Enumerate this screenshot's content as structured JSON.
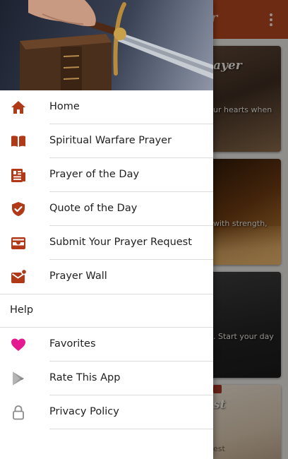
{
  "colors": {
    "accent": "#b2461f",
    "drawer_icon": "#b03a18",
    "favorites_icon": "#e5198f",
    "muted_icon": "#8a8a8a"
  },
  "appbar": {
    "title_fragment": "er",
    "menu_icon": "more-vert-icon"
  },
  "cards": [
    {
      "title_fragment": "ayer",
      "text_fragment": "ur hearts when"
    },
    {
      "title_fragment": "",
      "text_fragment": "with strength,"
    },
    {
      "title_fragment": "",
      "text_fragment": ". Start your day"
    },
    {
      "title_fragment": "st",
      "text_fragment": "est"
    }
  ],
  "drawer": {
    "header_image": "hand-on-bible-with-sword",
    "items": [
      {
        "label": "Home",
        "icon": "home-icon"
      },
      {
        "label": "Spiritual Warfare Prayer",
        "icon": "book-icon"
      },
      {
        "label": "Prayer of the Day",
        "icon": "article-icon"
      },
      {
        "label": "Quote of the Day",
        "icon": "shield-check-icon"
      },
      {
        "label": "Submit Your Prayer Request",
        "icon": "inbox-icon"
      },
      {
        "label": "Prayer Wall",
        "icon": "mail-notification-icon"
      }
    ],
    "section_label": "Help",
    "help_items": [
      {
        "label": "Favorites",
        "icon": "heart-icon"
      },
      {
        "label": "Rate This App",
        "icon": "play-store-icon"
      },
      {
        "label": "Privacy Policy",
        "icon": "lock-icon"
      }
    ]
  }
}
